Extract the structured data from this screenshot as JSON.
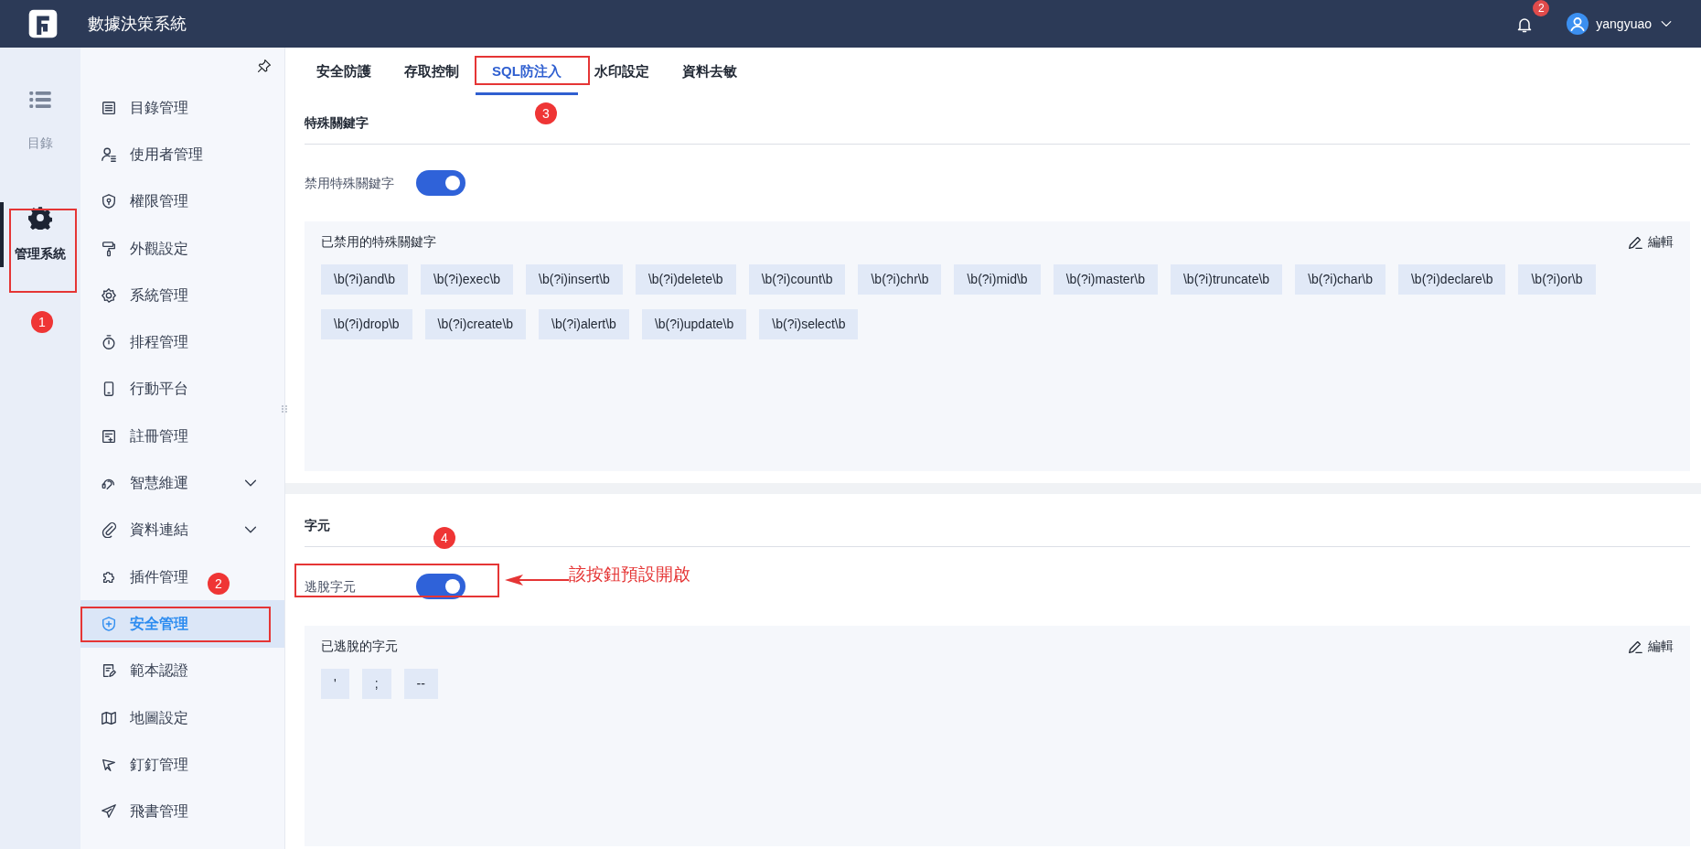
{
  "app": {
    "title": "數據決策系統"
  },
  "header": {
    "notification_count": "2",
    "user": "yangyuao"
  },
  "rail": [
    {
      "label": "目錄",
      "selected": false
    },
    {
      "label": "管理系統",
      "selected": true
    }
  ],
  "menu": [
    {
      "label": "目錄管理",
      "selected": false
    },
    {
      "label": "使用者管理",
      "selected": false
    },
    {
      "label": "權限管理",
      "selected": false
    },
    {
      "label": "外觀設定",
      "selected": false
    },
    {
      "label": "系統管理",
      "selected": false
    },
    {
      "label": "排程管理",
      "selected": false
    },
    {
      "label": "行動平台",
      "selected": false
    },
    {
      "label": "註冊管理",
      "selected": false
    },
    {
      "label": "智慧維運",
      "selected": false,
      "expanded": false
    },
    {
      "label": "資料連結",
      "selected": false,
      "expanded": false
    },
    {
      "label": "插件管理",
      "selected": false
    },
    {
      "label": "安全管理",
      "selected": true
    },
    {
      "label": "範本認證",
      "selected": false
    },
    {
      "label": "地圖設定",
      "selected": false
    },
    {
      "label": "釘釘管理",
      "selected": false
    },
    {
      "label": "飛書管理",
      "selected": false
    }
  ],
  "tabs": [
    {
      "label": "安全防護",
      "selected": false
    },
    {
      "label": "存取控制",
      "selected": false
    },
    {
      "label": "SQL防注入",
      "selected": true
    },
    {
      "label": "水印設定",
      "selected": false
    },
    {
      "label": "資料去敏",
      "selected": false
    }
  ],
  "sections": [
    {
      "title": "特殊關鍵字",
      "toggle": {
        "label": "禁用特殊關鍵字",
        "on": true
      },
      "panel": {
        "title": "已禁用的特殊關鍵字",
        "edit": "編輯",
        "tags": [
          "\\b(?i)and\\b",
          "\\b(?i)exec\\b",
          "\\b(?i)insert\\b",
          "\\b(?i)delete\\b",
          "\\b(?i)count\\b",
          "\\b(?i)chr\\b",
          "\\b(?i)mid\\b",
          "\\b(?i)master\\b",
          "\\b(?i)truncate\\b",
          "\\b(?i)char\\b",
          "\\b(?i)declare\\b",
          "\\b(?i)or\\b",
          "\\b(?i)drop\\b",
          "\\b(?i)create\\b",
          "\\b(?i)alert\\b",
          "\\b(?i)update\\b",
          "\\b(?i)select\\b"
        ]
      }
    },
    {
      "title": "字元",
      "toggle": {
        "label": "逃脫字元",
        "on": true
      },
      "panel": {
        "title": "已逃脫的字元",
        "edit": "編輯",
        "tags": [
          "'",
          ";",
          "--"
        ]
      }
    }
  ],
  "annotations": {
    "steps": [
      "1",
      "2",
      "3",
      "4"
    ],
    "callout": "該按鈕預設開啟"
  }
}
